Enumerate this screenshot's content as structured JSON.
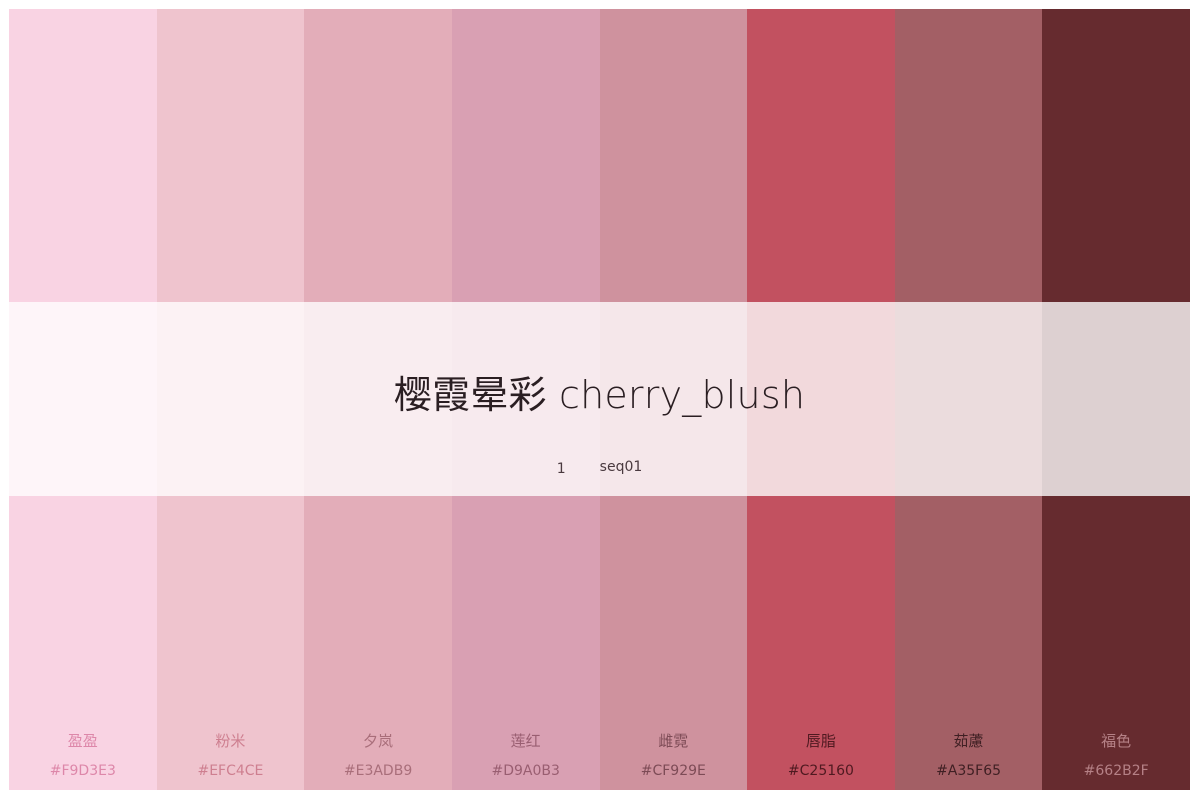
{
  "title": "樱霞晕彩 cherry_blush",
  "index": "1",
  "sequence": "seq01",
  "swatches": [
    {
      "name": "盈盈",
      "hex": "#F9D3E3",
      "text_color": "#d97aa0"
    },
    {
      "name": "粉米",
      "hex": "#EFC4CE",
      "text_color": "#c97486"
    },
    {
      "name": "夕岚",
      "hex": "#E3ADB9",
      "text_color": "#9f6470"
    },
    {
      "name": "莲红",
      "hex": "#D9A0B3",
      "text_color": "#8f5366"
    },
    {
      "name": "雌霓",
      "hex": "#CF929E",
      "text_color": "#6f3f4a"
    },
    {
      "name": "唇脂",
      "hex": "#C25160",
      "text_color": "#3b1016"
    },
    {
      "name": "茹藘",
      "hex": "#A35F65",
      "text_color": "#2e1518"
    },
    {
      "name": "福色",
      "hex": "#662B2F",
      "text_color": "#c39096"
    }
  ]
}
